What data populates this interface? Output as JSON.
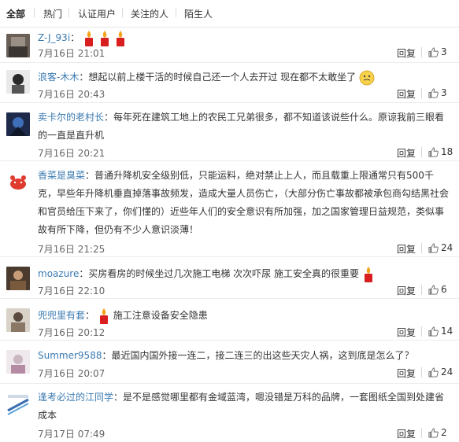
{
  "tabs": [
    {
      "label": "全部",
      "active": true
    },
    {
      "label": "热门",
      "active": false
    },
    {
      "label": "认证用户",
      "active": false
    },
    {
      "label": "关注的人",
      "active": false
    },
    {
      "label": "陌生人",
      "active": false
    }
  ],
  "reply_label": "回复",
  "comments": [
    {
      "user": "Z-J_93i",
      "sep": "：",
      "text": "",
      "time": "7月16日 21:01",
      "likes": "3",
      "candles": 3
    },
    {
      "user": "浪客-木木",
      "sep": "：",
      "text": "想起以前上楼干活的时候自己还一个人去开过  现在都不太敢坐了",
      "time": "7月16日 20:43",
      "likes": "3",
      "smile": true
    },
    {
      "user": "卖卡尔的老村长",
      "sep": "：",
      "text": "每年死在建筑工地上的农民工兄弟很多，都不知道该说些什么。原谅我前三眼看的一直是直升机",
      "time": "7月16日 20:21",
      "likes": "18"
    },
    {
      "user": "香菜是臭菜",
      "sep": "：",
      "text": "普通升降机安全级别低，只能运料，绝对禁止上人，而且载重上限通常只有500千克，早些年升降机垂直掉落事故频发，造成大量人员伤亡，（大部分伤亡事故都被承包商勾结黑社会和官员给压下来了，你们懂的）近些年人们的安全意识有所加强，加之国家管理日益规范，类似事故有所下降，但仍有不少人意识淡薄！",
      "time": "7月16日 21:25",
      "likes": "24"
    },
    {
      "user": "moazure",
      "sep": "：",
      "text": "买房看房的时候坐过几次施工电梯 次次吓尿 施工安全真的很重要",
      "time": "7月16日 22:10",
      "likes": "6",
      "candles": 1
    },
    {
      "user": "兜兜里有套",
      "sep": "：",
      "text": "施工注意设备安全隐患",
      "time": "7月16日 20:12",
      "likes": "14",
      "candle_before": true
    },
    {
      "user": "Summer9588",
      "sep": "：",
      "text": "最近国内国外接一连二，接二连三的出这些天灾人祸，这到底是怎么了？",
      "time": "7月16日 20:07",
      "likes": "24"
    },
    {
      "user": "逢考必过的江同学",
      "sep": "：",
      "text": "是不是感觉哪里都有金域蓝湾，嗯没错是万科的品牌，一套图纸全国到处建省成本",
      "time": "7月17日 07:49",
      "likes": "2"
    }
  ]
}
